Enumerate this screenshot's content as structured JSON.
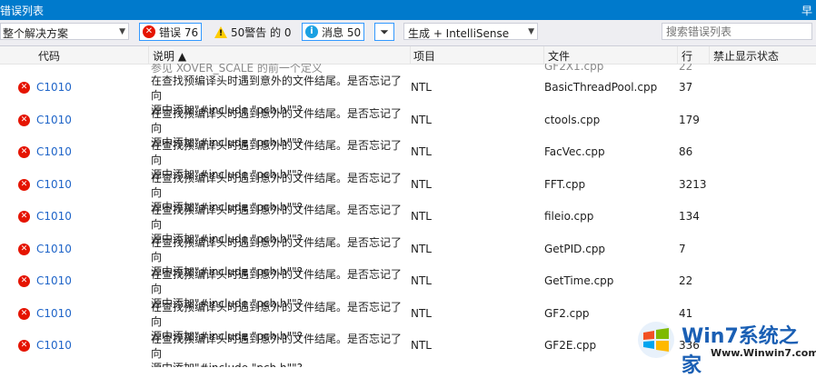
{
  "window": {
    "title": "错误列表",
    "pin_label": "早"
  },
  "toolbar": {
    "scope_value": "整个解决方案",
    "errors_label": "错误 76",
    "warnings_label": "50警告 的 0",
    "messages_label": "消息 50",
    "build_value": "生成 + IntelliSense",
    "search_placeholder": "搜索错误列表"
  },
  "columns": {
    "code": "代码",
    "description": "说明 ▲",
    "project": "项目",
    "file": "文件",
    "line": "行",
    "suppression": "禁止显示状态"
  },
  "partial_top_text": "参见 XOVER_SCALE 的前一个定义",
  "partial_top_file": "GF2X1.cpp",
  "partial_top_line": "22",
  "rows": [
    {
      "code": "C1010",
      "desc1": " 在查找预编译头时遇到意外的文件结尾。是否忘记了向",
      "desc2": "源中添加\"#include \"pch.h\"\"?",
      "project": "NTL",
      "file": "BasicThreadPool.cpp",
      "line": "37"
    },
    {
      "code": "C1010",
      "desc1": " 在查找预编译头时遇到意外的文件结尾。是否忘记了向",
      "desc2": "源中添加\"#include \"pch.h\"\"?",
      "project": "NTL",
      "file": "ctools.cpp",
      "line": "179"
    },
    {
      "code": "C1010",
      "desc1": " 在查找预编译头时遇到意外的文件结尾。是否忘记了向",
      "desc2": "源中添加\"#include \"pch.h\"\"?",
      "project": "NTL",
      "file": "FacVec.cpp",
      "line": "86"
    },
    {
      "code": "C1010",
      "desc1": " 在查找预编译头时遇到意外的文件结尾。是否忘记了向",
      "desc2": "源中添加\"#include \"pch.h\"\"?",
      "project": "NTL",
      "file": "FFT.cpp",
      "line": "3213"
    },
    {
      "code": "C1010",
      "desc1": " 在查找预编译头时遇到意外的文件结尾。是否忘记了向",
      "desc2": "源中添加\"#include \"pch.h\"\"?",
      "project": "NTL",
      "file": "fileio.cpp",
      "line": "134"
    },
    {
      "code": "C1010",
      "desc1": " 在查找预编译头时遇到意外的文件结尾。是否忘记了向",
      "desc2": "源中添加\"#include \"pch.h\"\"?",
      "project": "NTL",
      "file": "GetPID.cpp",
      "line": "7"
    },
    {
      "code": "C1010",
      "desc1": " 在查找预编译头时遇到意外的文件结尾。是否忘记了向",
      "desc2": "源中添加\"#include \"pch.h\"\"?",
      "project": "NTL",
      "file": "GetTime.cpp",
      "line": "22"
    },
    {
      "code": "C1010",
      "desc1": " 在查找预编译头时遇到意外的文件结尾。是否忘记了向",
      "desc2": "源中添加\"#include \"pch.h\"\"?",
      "project": "NTL",
      "file": "GF2.cpp",
      "line": "41"
    },
    {
      "code": "C1010",
      "desc1": " 在查找预编译头时遇到意外的文件结尾。是否忘记了向",
      "desc2": "源中添加\"#include \"pch.h\"\"?",
      "project": "NTL",
      "file": "GF2E.cpp",
      "line": "336"
    }
  ],
  "watermark": {
    "title": "Win7系统之家",
    "url": "Www.Winwin7.com"
  },
  "colors": {
    "accent": "#007acc",
    "error": "#e51400",
    "link": "#1e64c8"
  }
}
